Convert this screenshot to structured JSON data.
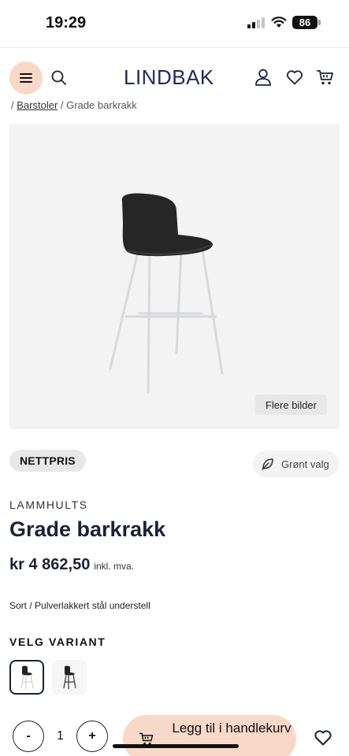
{
  "status_bar": {
    "time": "19:29",
    "battery": "86"
  },
  "header": {
    "logo": "LINDBAK",
    "icons": [
      "menu-icon",
      "search-icon",
      "user-icon",
      "heart-icon",
      "cart-icon"
    ]
  },
  "breadcrumb": {
    "parent": "Barstoler",
    "separator": "/",
    "current": "Grade barkrakk"
  },
  "product_image": {
    "more_images_label": "Flere bilder"
  },
  "badges": {
    "nettpris": "NETTPRIS",
    "green_choice": "Grønt valg"
  },
  "product": {
    "brand": "LAMMHULTS",
    "title": "Grade barkrakk",
    "price": "kr 4 862,50",
    "vat_note": "inkl. mva.",
    "description": "Sort / Pulverlakkert stål understell"
  },
  "variants": {
    "label": "VELG VARIANT",
    "selected_index": 0,
    "count": 2
  },
  "purchase": {
    "minus_label": "-",
    "quantity": "1",
    "plus_label": "+",
    "add_to_cart_label": "Legg til i handlekurv"
  },
  "colors": {
    "accent": "#f8d9c8",
    "brand_navy": "#1e2a5c",
    "image_bg": "#f3f3f3"
  }
}
